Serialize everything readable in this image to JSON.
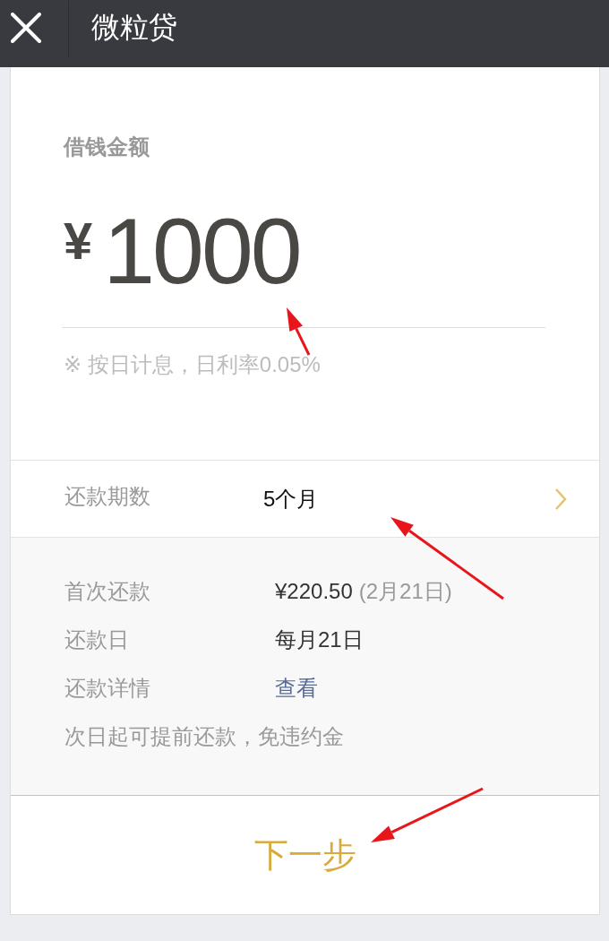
{
  "header": {
    "title": "微粒贷"
  },
  "loan": {
    "label": "借钱金额",
    "currency": "¥",
    "amount": "1000",
    "note": "※ 按日计息，日利率0.05%"
  },
  "term": {
    "label": "还款期数",
    "value": "5个月"
  },
  "details": [
    {
      "kind": "amount",
      "label": "首次还款",
      "value": "¥220.50",
      "date": "(2月21日)"
    },
    {
      "kind": "text",
      "label": "还款日",
      "value": "每月21日"
    },
    {
      "kind": "link",
      "label": "还款详情",
      "value": "查看"
    }
  ],
  "notice": "次日起可提前还款，免违约金",
  "next_button": {
    "label": "下一步"
  }
}
